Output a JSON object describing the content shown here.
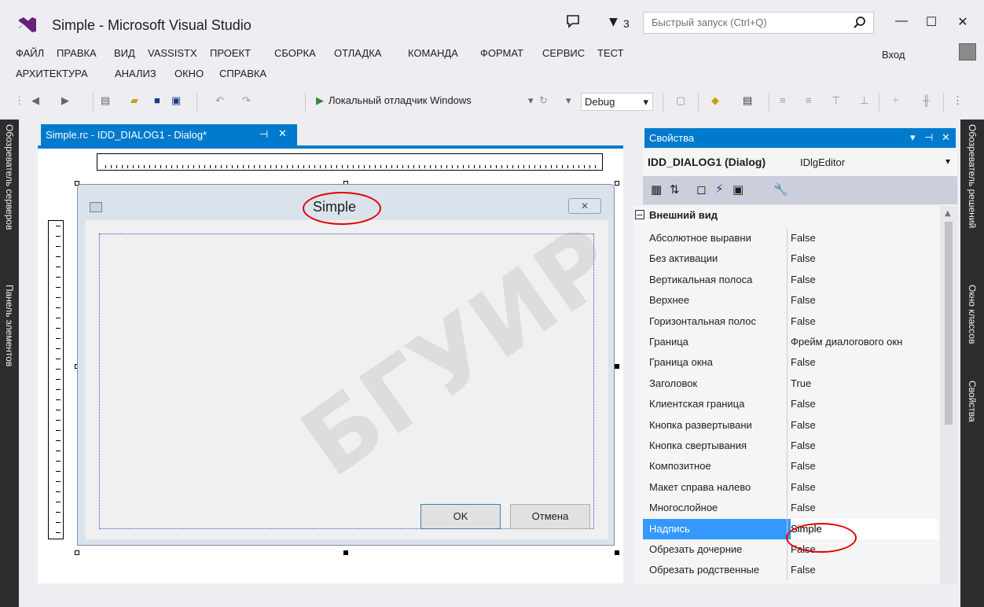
{
  "title": "Simple - Microsoft Visual Studio",
  "notifications": {
    "count": "3"
  },
  "quick_launch": {
    "placeholder": "Быстрый запуск (Ctrl+Q)"
  },
  "window_buttons": {
    "minimize": "—",
    "maximize": "☐",
    "close": "✕"
  },
  "menu": [
    {
      "label": "ФАЙЛ"
    },
    {
      "label": "ПРАВКА"
    },
    {
      "label": "ВИД"
    },
    {
      "label": "VASSISTX"
    },
    {
      "label": "ПРОЕКТ"
    },
    {
      "label": "СБОРКА"
    },
    {
      "label": "ОТЛАДКА"
    },
    {
      "label": "КОМАНДА"
    },
    {
      "label": "ФОРМАТ"
    },
    {
      "label": "СЕРВИС"
    },
    {
      "label": "ТЕСТ"
    },
    {
      "label": "АРХИТЕКТУРА"
    },
    {
      "label": "АНАЛИЗ"
    },
    {
      "label": "ОКНО"
    },
    {
      "label": "СПРАВКА"
    }
  ],
  "login": "Вход",
  "toolbar": {
    "debugger": "Локальный отладчик Windows",
    "configuration": "Debug"
  },
  "left_tabs": {
    "server_explorer": "Обозреватель серверов",
    "toolbox": "Панель элементов"
  },
  "right_tabs": {
    "solution_explorer": "Обозреватель решений",
    "class_view": "Окно классов",
    "properties": "Свойства"
  },
  "document_tab": {
    "label": "Simple.rc - IDD_DIALOG1 - Dialog*"
  },
  "dialog": {
    "caption": "Simple",
    "ok": "OK",
    "cancel": "Отмена"
  },
  "properties": {
    "header": "Свойства",
    "object_name": "IDD_DIALOG1 (Dialog)",
    "object_type": "IDlgEditor",
    "category": "Внешний вид",
    "rows": [
      {
        "name": "Абсолютное выравни",
        "value": "False"
      },
      {
        "name": "Без активации",
        "value": "False"
      },
      {
        "name": "Вертикальная полоса",
        "value": "False"
      },
      {
        "name": "Верхнее",
        "value": "False"
      },
      {
        "name": "Горизонтальная полос",
        "value": "False"
      },
      {
        "name": "Граница",
        "value": "Фрейм диалогового окн"
      },
      {
        "name": "Граница окна",
        "value": "False"
      },
      {
        "name": "Заголовок",
        "value": "True"
      },
      {
        "name": "Клиентская граница",
        "value": "False"
      },
      {
        "name": "Кнопка развертывани",
        "value": "False"
      },
      {
        "name": "Кнопка свертывания",
        "value": "False"
      },
      {
        "name": "Композитное",
        "value": "False"
      },
      {
        "name": "Макет справа налево",
        "value": "False"
      },
      {
        "name": "Многослойное",
        "value": "False"
      },
      {
        "name": "Надпись",
        "value": "Simple"
      },
      {
        "name": "Обрезать дочерние",
        "value": "False"
      },
      {
        "name": "Обрезать родственные",
        "value": "False"
      }
    ]
  },
  "colors": {
    "accent": "#007acc",
    "selection": "#3399ff",
    "annotation": "#e20000",
    "dark_tab": "#2d2d30"
  }
}
